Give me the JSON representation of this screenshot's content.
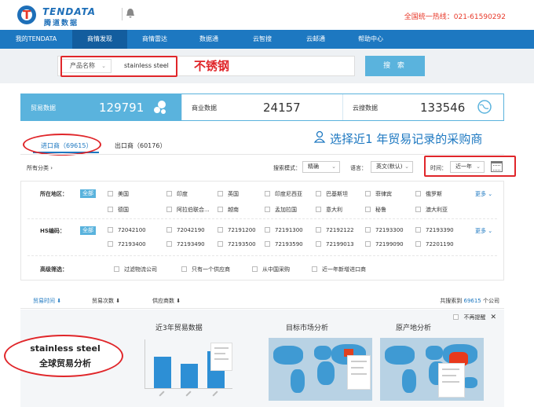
{
  "header": {
    "logo_en": "TENDATA",
    "logo_cn": "腾道数据",
    "logo_mark": "T",
    "hotline": "全国统一热线：021-61590292"
  },
  "nav": {
    "items": [
      {
        "label": "我的TENDATA",
        "active": false
      },
      {
        "label": "商情发现",
        "active": true
      },
      {
        "label": "商情雷达",
        "active": false
      },
      {
        "label": "数据通",
        "active": false
      },
      {
        "label": "云智搜",
        "active": false
      },
      {
        "label": "云邮通",
        "active": false
      },
      {
        "label": "帮助中心",
        "active": false
      }
    ]
  },
  "search": {
    "field_select": "产品名称",
    "query": "stainless steel",
    "button_label": "搜 索",
    "annotation": "不锈钢"
  },
  "stats": [
    {
      "label": "贸易数据",
      "value": "129791",
      "active": true
    },
    {
      "label": "商业数据",
      "value": "24157",
      "active": false
    },
    {
      "label": "云搜数据",
      "value": "133546",
      "active": false
    }
  ],
  "annotation_blue": "选择近1 年贸易记录的采购商",
  "tabs": {
    "import_label": "进口商（69615）",
    "export_label": "出口商（60176）"
  },
  "toolbar": {
    "all_categories": "所有分类",
    "search_mode_label": "搜索模式：",
    "search_mode_value": "精确",
    "language_label": "语言：",
    "language_value": "英文(默认)",
    "time_label": "时间：",
    "time_value": "近一年"
  },
  "filters": {
    "region_label": "所在地区：",
    "all_label": "全部",
    "regions": [
      "美国",
      "印度",
      "英国",
      "印度尼西亚",
      "巴基斯坦",
      "菲律宾",
      "俄罗斯",
      "德国",
      "阿拉伯联合...",
      "越南",
      "孟加拉国",
      "意大利",
      "秘鲁",
      "澳大利亚"
    ],
    "hs_label": "HS编码：",
    "hs_codes": [
      "72042100",
      "72042190",
      "72191200",
      "72191300",
      "72192122",
      "72193300",
      "72193390",
      "72193400",
      "72193490",
      "72193500",
      "72193590",
      "72199013",
      "72199090",
      "72201190"
    ],
    "more_label": "更多",
    "advanced_label": "高级筛选：",
    "advanced_options": [
      "过滤物流公司",
      "只有一个供应商",
      "从中国采购",
      "近一年新增进口商"
    ]
  },
  "sortbar": {
    "sorts": [
      "贸易时间",
      "贸易次数",
      "供应商数"
    ],
    "total_prefix": "共搜索到 ",
    "total_count": "69615",
    "total_suffix": " 个公司"
  },
  "analysis": {
    "trade_title": "近3年贸易数据",
    "target_title": "目标市场分析",
    "origin_title": "原产地分析",
    "no_remind": "不再提醒",
    "annotation_line1": "stainless steel",
    "annotation_line2": "全球贸易分析"
  },
  "chart_data": {
    "type": "bar",
    "title": "近3年贸易数据",
    "categories": [
      "",
      "",
      ""
    ],
    "values": [
      26,
      20,
      30
    ],
    "ylim": [
      0,
      40
    ]
  },
  "colors": {
    "nav": "#1d78c1",
    "accent": "#5ab3dd",
    "annotation": "#e0262a"
  }
}
